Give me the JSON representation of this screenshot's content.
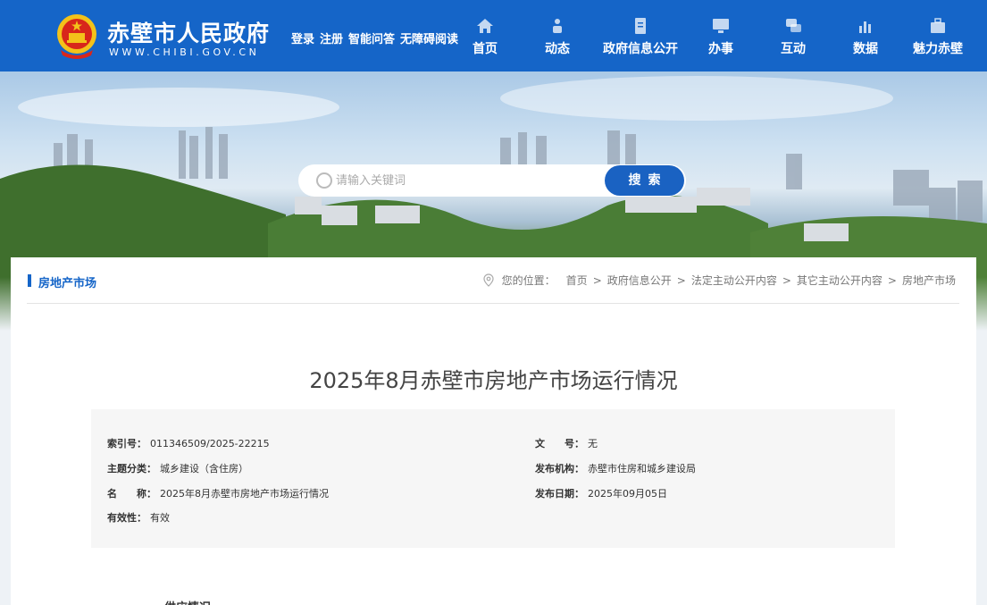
{
  "header": {
    "site_title": "赤壁市人民政府",
    "site_url": "WWW.CHIBI.GOV.CN",
    "quick_links": [
      "登录",
      "注册",
      "智能问答",
      "无障碍阅读"
    ],
    "nav": [
      {
        "label": "首页",
        "icon": "home-icon"
      },
      {
        "label": "动态",
        "icon": "news-icon"
      },
      {
        "label": "政府信息公开",
        "icon": "document-icon"
      },
      {
        "label": "办事",
        "icon": "monitor-icon"
      },
      {
        "label": "互动",
        "icon": "chat-icon"
      },
      {
        "label": "数据",
        "icon": "bar-chart-icon"
      },
      {
        "label": "魅力赤壁",
        "icon": "briefcase-icon"
      }
    ]
  },
  "search": {
    "placeholder": "请输入关键词",
    "button": "搜索"
  },
  "column": {
    "title": "房地产市场"
  },
  "breadcrumb": {
    "prefix": "您的位置：",
    "items": [
      "首页",
      "政府信息公开",
      "法定主动公开内容",
      "其它主动公开内容",
      "房地产市场"
    ],
    "separator": ">"
  },
  "article": {
    "title": "2025年8月赤壁市房地产市场运行情况",
    "meta": {
      "index_label": "索引号：",
      "index_value": "011346509/2025-22215",
      "doc_no_label": "文　　号：",
      "doc_no_value": "无",
      "topic_label": "主题分类：",
      "topic_value": "城乡建设（含住房）",
      "org_label": "发布机构：",
      "org_value": "赤壁市住房和城乡建设局",
      "name_label": "名　　称：",
      "name_value": "2025年8月赤壁市房地产市场运行情况",
      "date_label": "发布日期：",
      "date_value": "2025年09月05日",
      "validity_label": "有效性：",
      "validity_value": "有效"
    },
    "section_heading": "一、供应情况"
  },
  "colors": {
    "brand": "#1565c8",
    "search_button": "#1a62c2"
  }
}
